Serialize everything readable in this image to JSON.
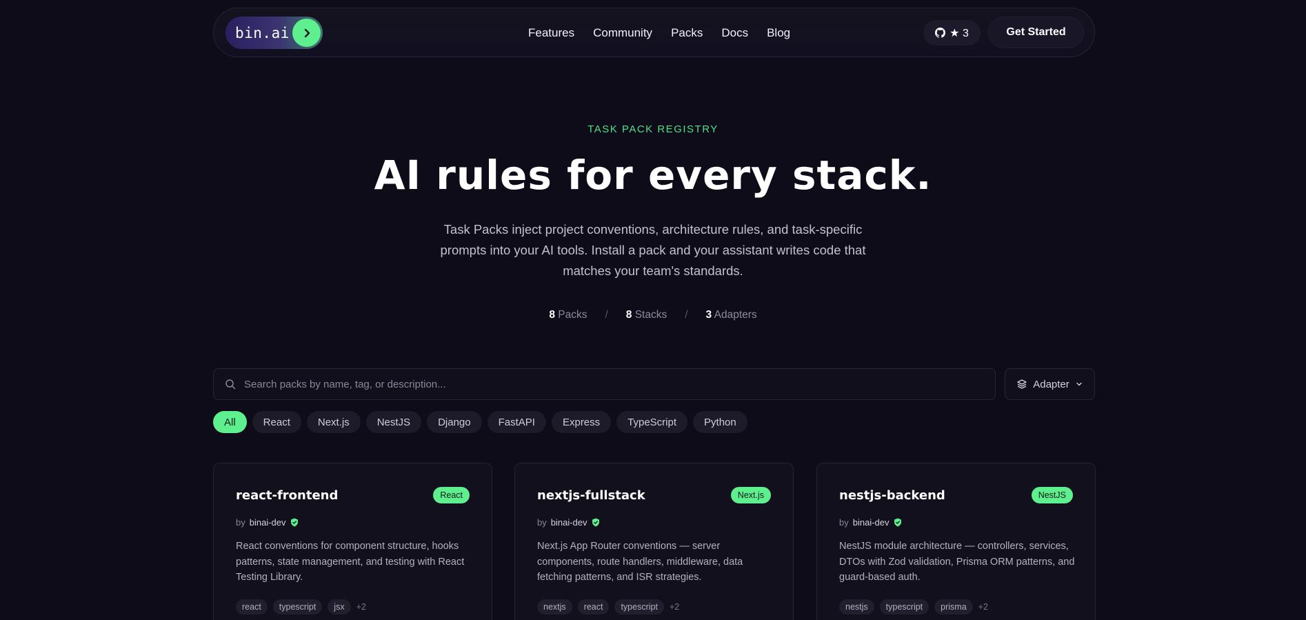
{
  "nav": {
    "logo_text": "bin.ai",
    "links": [
      "Features",
      "Community",
      "Packs",
      "Docs",
      "Blog"
    ],
    "github_stars": "★ 3",
    "cta_label": "Get Started"
  },
  "hero": {
    "eyebrow": "TASK PACK REGISTRY",
    "title": "AI rules for every stack.",
    "subtitle": "Task Packs inject project conventions, architecture rules, and task-specific prompts into your AI tools. Install a pack and your assistant writes code that matches your team's standards.",
    "stats": [
      {
        "value": "8",
        "label": "Packs"
      },
      {
        "value": "8",
        "label": "Stacks"
      },
      {
        "value": "3",
        "label": "Adapters"
      }
    ],
    "stat_separator": "/"
  },
  "search": {
    "placeholder": "Search packs by name, tag, or description...",
    "adapter_label": "Adapter"
  },
  "filters": [
    "All",
    "React",
    "Next.js",
    "NestJS",
    "Django",
    "FastAPI",
    "Express",
    "TypeScript",
    "Python"
  ],
  "active_filter": "All",
  "cards": [
    {
      "title": "react-frontend",
      "badge": "React",
      "by": "by",
      "author": "binai-dev",
      "description": "React conventions for component structure, hooks patterns, state management, and testing with React Testing Library.",
      "tags": [
        "react",
        "typescript",
        "jsx"
      ],
      "more": "+2"
    },
    {
      "title": "nextjs-fullstack",
      "badge": "Next.js",
      "by": "by",
      "author": "binai-dev",
      "description": "Next.js App Router conventions — server components, route handlers, middleware, data fetching patterns, and ISR strategies.",
      "tags": [
        "nextjs",
        "react",
        "typescript"
      ],
      "more": "+2"
    },
    {
      "title": "nestjs-backend",
      "badge": "NestJS",
      "by": "by",
      "author": "binai-dev",
      "description": "NestJS module architecture — controllers, services, DTOs with Zod validation, Prisma ORM patterns, and guard-based auth.",
      "tags": [
        "nestjs",
        "typescript",
        "prisma"
      ],
      "more": "+2"
    }
  ],
  "colors": {
    "background": "#0e0c18",
    "accent": "#5ef08f",
    "eyebrow": "#4fe08a"
  },
  "icons": [
    "chevron-right-icon",
    "github-icon",
    "search-icon",
    "layers-icon",
    "chevron-down-icon",
    "verified-shield-icon"
  ]
}
